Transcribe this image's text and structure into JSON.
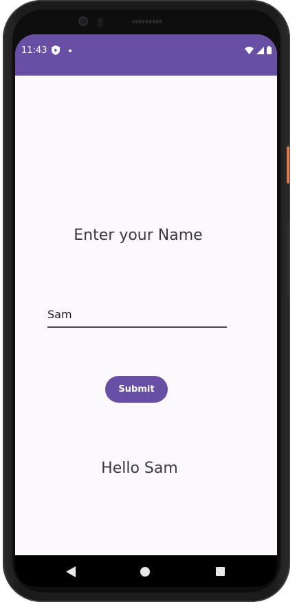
{
  "status_bar": {
    "time": "11:43",
    "icons": [
      "shield-play-icon",
      "notification-dot-icon",
      "wifi-icon",
      "signal-icon",
      "battery-icon"
    ],
    "color": "#6750a4"
  },
  "main": {
    "title": "Enter your Name",
    "name_input": {
      "value": "Sam",
      "placeholder": ""
    },
    "submit_label": "Submit",
    "greeting": "Hello Sam"
  },
  "nav_bar": {
    "icons": [
      "back-icon",
      "home-icon",
      "recents-icon"
    ]
  },
  "colors": {
    "accent": "#6750a4",
    "background": "#fdf8fc",
    "text": "#3a3a3d"
  }
}
